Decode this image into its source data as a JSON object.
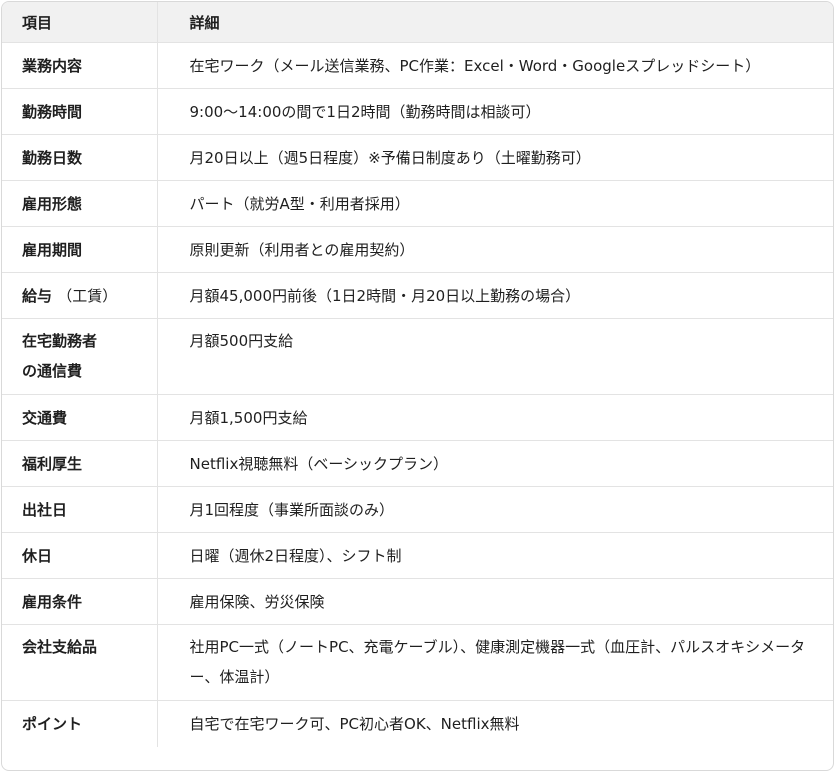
{
  "header": {
    "col1": "項目",
    "col2": "詳細"
  },
  "rows": [
    {
      "label": "業務内容",
      "detail": "在宅ワーク（メール送信業務、PC作業：Excel・Word・Googleスプレッドシート）"
    },
    {
      "label": "勤務時間",
      "detail": "9:00〜14:00の間で1日2時間（勤務時間は相談可）"
    },
    {
      "label": "勤務日数",
      "detail": "月20日以上（週5日程度）※予備日制度あり（土曜勤務可）"
    },
    {
      "label": "雇用形態",
      "detail": "パート（就労A型・利用者採用）"
    },
    {
      "label": "雇用期間",
      "detail": "原則更新（利用者との雇用契約）"
    },
    {
      "label": "給与",
      "label_sub": "（工賃）",
      "detail": "月額45,000円前後（1日2時間・月20日以上勤務の場合）"
    },
    {
      "label_line1": "在宅勤務者",
      "label_line2": "の通信費",
      "detail": "月額500円支給"
    },
    {
      "label": "交通費",
      "detail": "月額1,500円支給"
    },
    {
      "label": "福利厚生",
      "detail": "Netflix視聴無料（ベーシックプラン）"
    },
    {
      "label": "出社日",
      "detail": "月1回程度（事業所面談のみ）"
    },
    {
      "label": "休日",
      "detail": "日曜（週休2日程度）、シフト制"
    },
    {
      "label": "雇用条件",
      "detail": "雇用保険、労災保険"
    },
    {
      "label": "会社支給品",
      "detail": "社用PC一式（ノートPC、充電ケーブル）、健康測定機器一式（血圧計、パルスオキシメーター、体温計）"
    },
    {
      "label": "ポイント",
      "detail": "自宅で在宅ワーク可、PC初心者OK、Netflix無料"
    }
  ]
}
